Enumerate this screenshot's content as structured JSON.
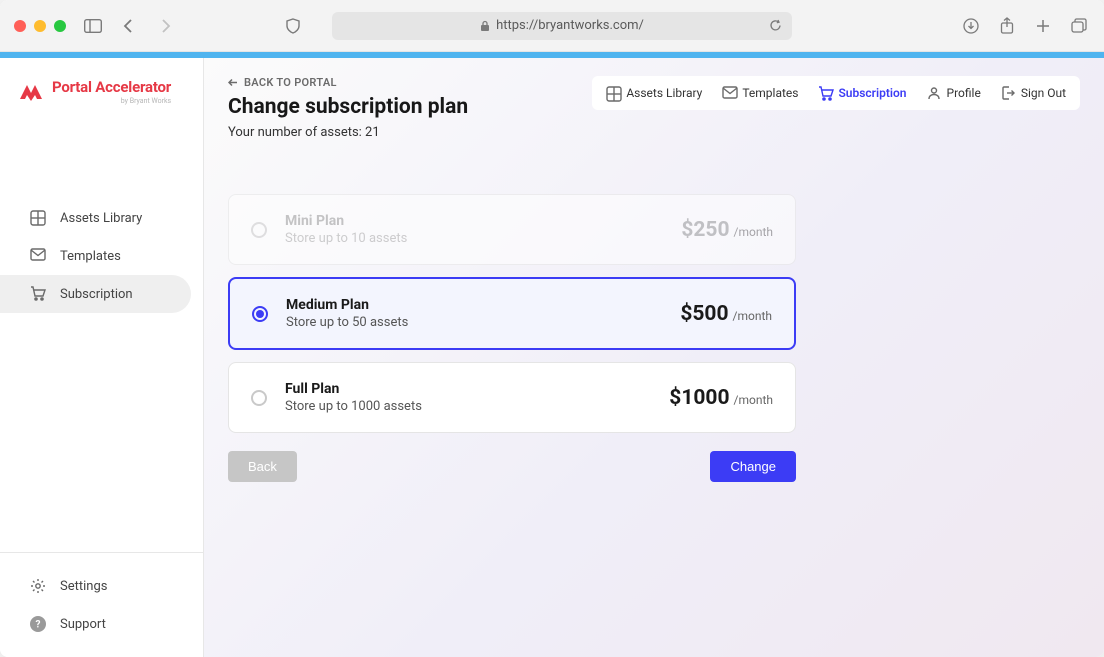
{
  "browser": {
    "url": "https://bryantworks.com/"
  },
  "brand": {
    "title": "Portal Accelerator",
    "subtitle": "by Bryant Works"
  },
  "sidebar": {
    "items": [
      {
        "label": "Assets Library",
        "icon": "grid-icon",
        "active": false
      },
      {
        "label": "Templates",
        "icon": "mail-icon",
        "active": false
      },
      {
        "label": "Subscription",
        "icon": "cart-icon",
        "active": true
      }
    ],
    "bottom": [
      {
        "label": "Settings",
        "icon": "gear-icon"
      },
      {
        "label": "Support",
        "icon": "question-icon"
      }
    ]
  },
  "topnav": {
    "items": [
      {
        "label": "Assets Library",
        "icon": "grid-icon",
        "active": false
      },
      {
        "label": "Templates",
        "icon": "mail-icon",
        "active": false
      },
      {
        "label": "Subscription",
        "icon": "cart-icon",
        "active": true
      },
      {
        "label": "Profile",
        "icon": "user-icon",
        "active": false
      },
      {
        "label": "Sign Out",
        "icon": "signout-icon",
        "active": false
      }
    ]
  },
  "header": {
    "back_label": "BACK TO PORTAL",
    "title": "Change subscription plan",
    "assets_label": "Your number of assets: 21"
  },
  "plans": [
    {
      "name": "Mini Plan",
      "desc": "Store up to 10 assets",
      "price": "$250",
      "period": "/month",
      "state": "disabled"
    },
    {
      "name": "Medium Plan",
      "desc": "Store up to 50 assets",
      "price": "$500",
      "period": "/month",
      "state": "selected"
    },
    {
      "name": "Full Plan",
      "desc": "Store up to 1000 assets",
      "price": "$1000",
      "period": "/month",
      "state": "normal"
    }
  ],
  "actions": {
    "back": "Back",
    "change": "Change"
  }
}
